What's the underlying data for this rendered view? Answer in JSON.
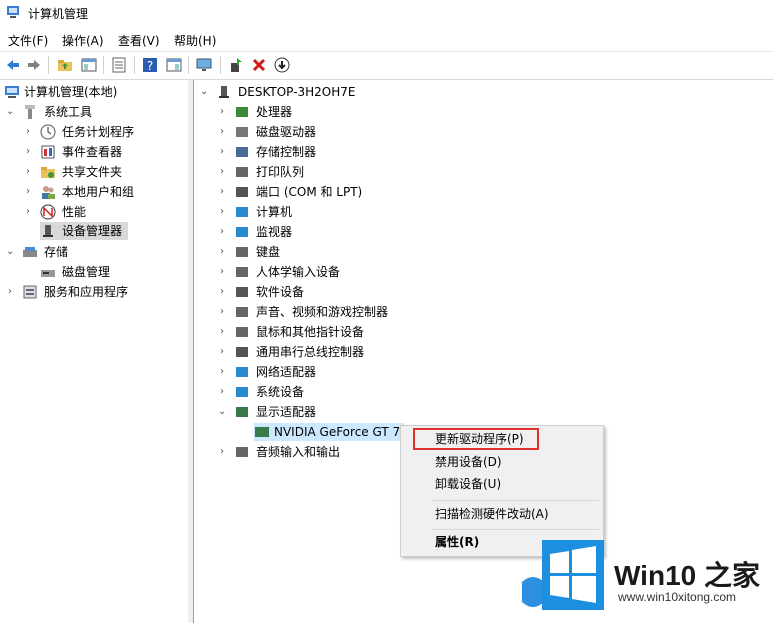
{
  "window": {
    "title": "计算机管理"
  },
  "menu": [
    "文件(F)",
    "操作(A)",
    "查看(V)",
    "帮助(H)"
  ],
  "toolbar_icons": [
    "back-icon",
    "forward-icon",
    "up-folder-icon",
    "show-hide-tree-icon",
    "export-list-icon",
    "help-icon",
    "properties-pane-icon",
    "monitor-icon",
    "update-driver-icon",
    "uninstall-icon",
    "disable-device-icon"
  ],
  "left_tree": [
    {
      "label": "计算机管理(本地)",
      "icon": "computer-management-icon"
    },
    {
      "label": "系统工具",
      "icon": "system-tools-icon"
    },
    {
      "label": "任务计划程序",
      "icon": "task-scheduler-icon"
    },
    {
      "label": "事件查看器",
      "icon": "event-viewer-icon"
    },
    {
      "label": "共享文件夹",
      "icon": "shared-folders-icon"
    },
    {
      "label": "本地用户和组",
      "icon": "local-users-icon"
    },
    {
      "label": "性能",
      "icon": "performance-icon"
    },
    {
      "label": "设备管理器",
      "icon": "device-manager-icon"
    },
    {
      "label": "存储",
      "icon": "storage-icon"
    },
    {
      "label": "磁盘管理",
      "icon": "disk-management-icon"
    },
    {
      "label": "服务和应用程序",
      "icon": "services-apps-icon"
    }
  ],
  "device_tree": {
    "root": "DESKTOP-3H2OH7E",
    "categories": [
      "处理器",
      "磁盘驱动器",
      "存储控制器",
      "打印队列",
      "端口 (COM 和 LPT)",
      "计算机",
      "监视器",
      "键盘",
      "人体学输入设备",
      "软件设备",
      "声音、视频和游戏控制器",
      "鼠标和其他指针设备",
      "通用串行总线控制器",
      "网络适配器",
      "系统设备",
      "显示适配器",
      "音频输入和输出"
    ],
    "expanded_child": "NVIDIA GeForce GT 7"
  },
  "context_menu": {
    "items": [
      "更新驱动程序(P)",
      "禁用设备(D)",
      "卸载设备(U)",
      "扫描检测硬件改动(A)",
      "属性(R)"
    ]
  },
  "watermark": {
    "brand": "Win10 之家",
    "url": "www.win10xitong.com"
  },
  "colors": {
    "highlight_box": "#e0312f",
    "win_blue": "#1c8fe0",
    "selection": "#d9d9d9"
  }
}
